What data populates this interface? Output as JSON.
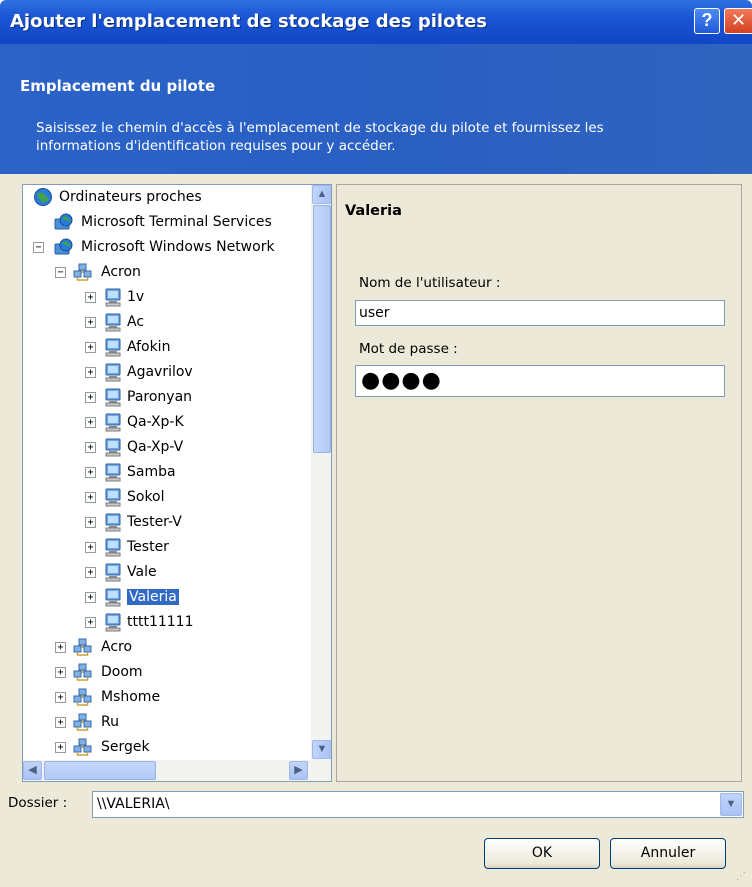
{
  "window": {
    "title": "Ajouter l'emplacement de stockage des pilotes",
    "help_glyph": "?",
    "close_glyph": "✕"
  },
  "header": {
    "title": "Emplacement du pilote",
    "description": "Saisissez le chemin d'accès à l'emplacement de stockage du pilote et fournissez les informations d'identification requises pour y accéder."
  },
  "tree": {
    "root": "Ordinateurs proches",
    "nodes": [
      {
        "label": "Microsoft Terminal Services",
        "icon": "network-globe-icon"
      },
      {
        "label": "Microsoft Windows Network",
        "icon": "network-globe-icon"
      },
      {
        "label": "Acron",
        "icon": "workgroup-icon"
      },
      {
        "label": "1v",
        "icon": "computer-icon"
      },
      {
        "label": "Ac",
        "icon": "computer-icon"
      },
      {
        "label": "Afokin",
        "icon": "computer-icon"
      },
      {
        "label": "Agavrilov",
        "icon": "computer-icon"
      },
      {
        "label": "Paronyan",
        "icon": "computer-icon"
      },
      {
        "label": "Qa-Xp-K",
        "icon": "computer-icon"
      },
      {
        "label": "Qa-Xp-V",
        "icon": "computer-icon"
      },
      {
        "label": "Samba",
        "icon": "computer-icon"
      },
      {
        "label": "Sokol",
        "icon": "computer-icon"
      },
      {
        "label": "Tester-V",
        "icon": "computer-icon"
      },
      {
        "label": "Tester",
        "icon": "computer-icon"
      },
      {
        "label": "Vale",
        "icon": "computer-icon"
      },
      {
        "label": "Valeria",
        "icon": "computer-icon",
        "selected": true
      },
      {
        "label": "tttt11111",
        "icon": "computer-icon"
      },
      {
        "label": "Acro",
        "icon": "workgroup-icon"
      },
      {
        "label": "Doom",
        "icon": "workgroup-icon"
      },
      {
        "label": "Mshome",
        "icon": "workgroup-icon"
      },
      {
        "label": "Ru",
        "icon": "workgroup-icon"
      },
      {
        "label": "Sergek",
        "icon": "workgroup-icon"
      }
    ],
    "vertical_scroll_position": 0,
    "horizontal_scroll_position": 0
  },
  "details": {
    "selected_title": "Valeria",
    "username_label": "Nom de l'utilisateur :",
    "username_value": "user",
    "password_label": "Mot de passe :",
    "password_value": "●●●●"
  },
  "folder": {
    "label": "Dossier :",
    "value": "\\\\VALERIA\\"
  },
  "buttons": {
    "ok": "OK",
    "cancel": "Annuler"
  },
  "colors": {
    "titlebar": "#1a55d4",
    "header": "#2b63c9",
    "selection": "#316ac5",
    "dialog_bg": "#ece9d8"
  }
}
